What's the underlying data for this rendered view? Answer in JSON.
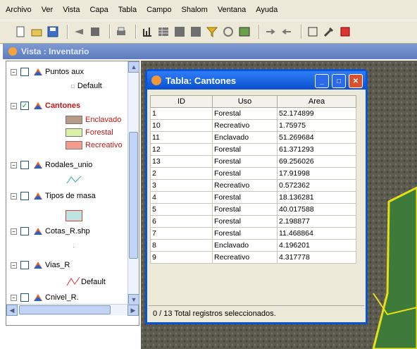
{
  "menubar": [
    "Archivo",
    "Ver",
    "Vista",
    "Capa",
    "Tabla",
    "Campo",
    "Shalom",
    "Ventana",
    "Ayuda"
  ],
  "view_title": "Vista : Inventario",
  "toc": {
    "layers": [
      {
        "label": "Puntos aux",
        "legend": "Default"
      },
      {
        "label": "Cantones",
        "legend_items": [
          "Enclavado",
          "Forestal",
          "Recreativo"
        ]
      },
      {
        "label": "Rodales_unio"
      },
      {
        "label": "Tipos de masa"
      },
      {
        "label": "Cotas_R.shp"
      },
      {
        "label": "Vias_R",
        "legend": "Default"
      },
      {
        "label": "Cnivel_R."
      }
    ]
  },
  "table_window": {
    "title": "Tabla: Cantones",
    "columns": [
      "ID",
      "Uso",
      "Area"
    ],
    "rows": [
      [
        "1",
        "Forestal",
        "52.174899"
      ],
      [
        "10",
        "Recreativo",
        "1.75975"
      ],
      [
        "11",
        "Enclavado",
        "51.269684"
      ],
      [
        "12",
        "Forestal",
        "61.371293"
      ],
      [
        "13",
        "Forestal",
        "69.256026"
      ],
      [
        "2",
        "Forestal",
        "17.91998"
      ],
      [
        "3",
        "Recreativo",
        "0.572362"
      ],
      [
        "4",
        "Forestal",
        "18.136281"
      ],
      [
        "5",
        "Forestal",
        "40.017588"
      ],
      [
        "6",
        "Forestal",
        "2.198877"
      ],
      [
        "7",
        "Forestal",
        "11.468864"
      ],
      [
        "8",
        "Enclavado",
        "4.196201"
      ],
      [
        "9",
        "Recreativo",
        "4.317778"
      ]
    ],
    "status": "0 / 13 Total registros seleccionados."
  },
  "colors": {
    "legend_enclavado": "#b79b86",
    "legend_forestal": "#d9f2a6",
    "legend_recreativo": "#f79a8e",
    "title_blue": "#0a50d0"
  }
}
